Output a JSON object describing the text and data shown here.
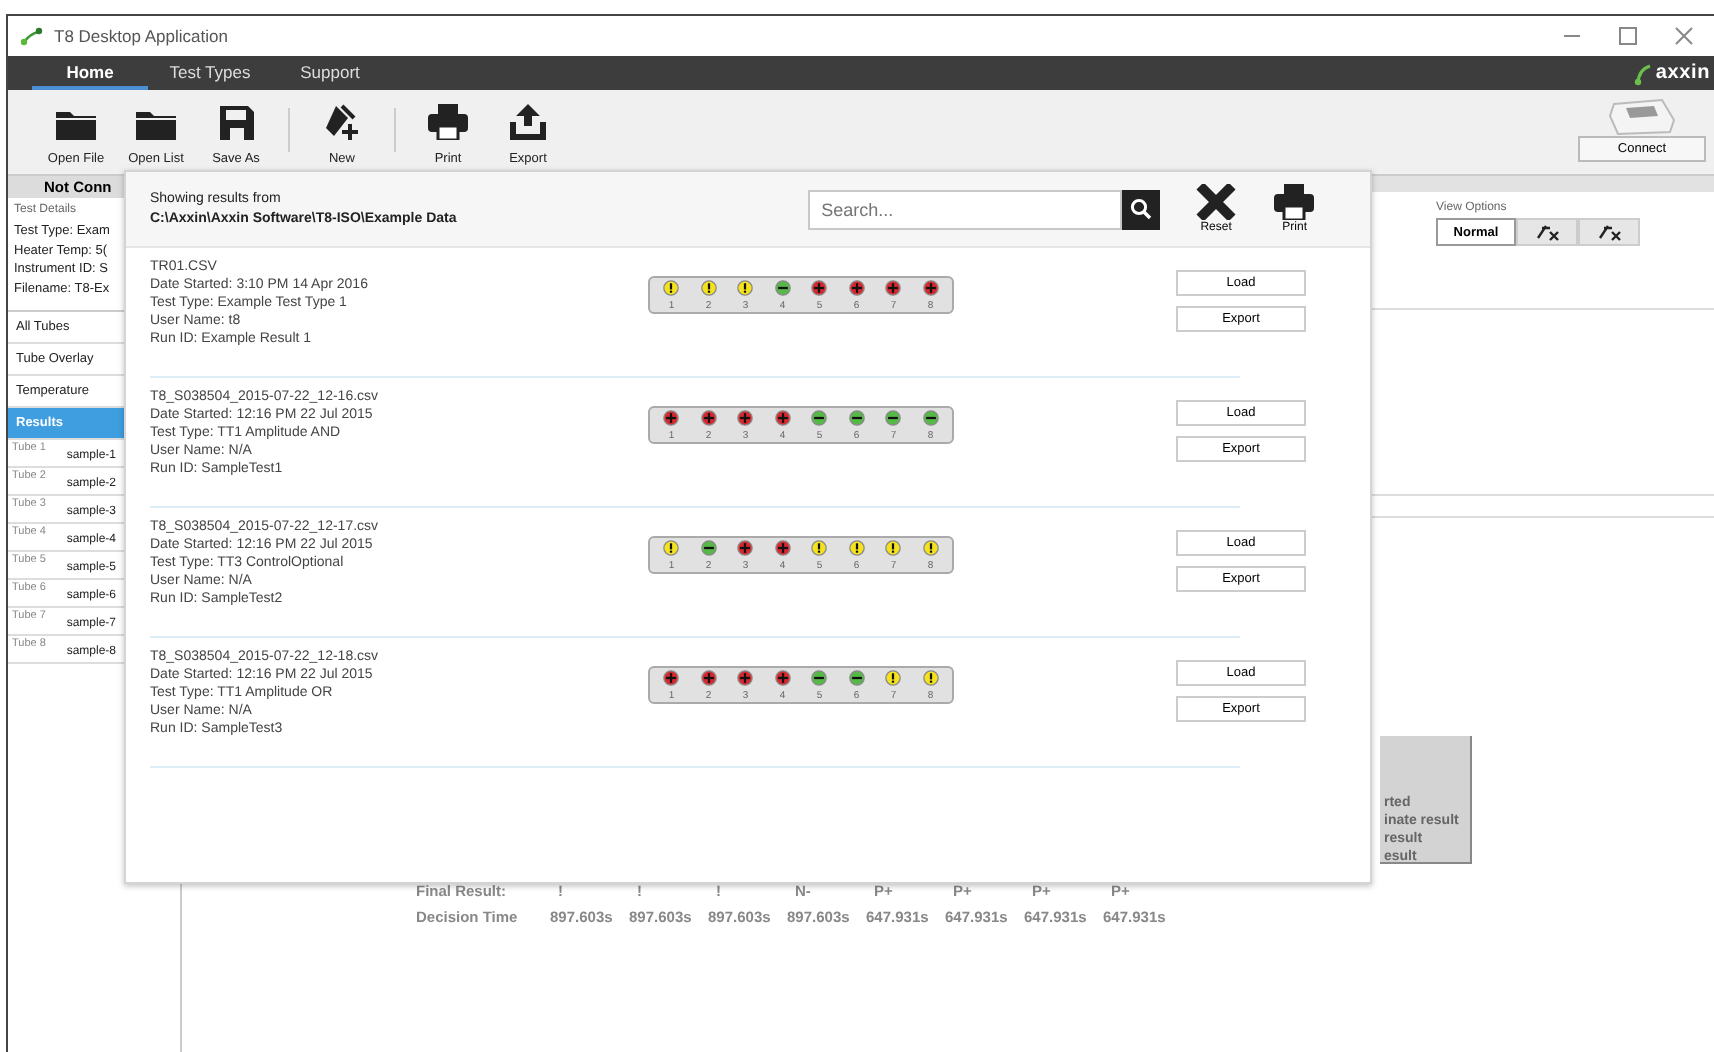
{
  "window": {
    "title": "T8 Desktop Application"
  },
  "menu_tabs": [
    {
      "label": "Home",
      "selected": true
    },
    {
      "label": "Test Types",
      "selected": false
    },
    {
      "label": "Support",
      "selected": false
    }
  ],
  "brand": "axxin",
  "toolbar": [
    {
      "label": "Open File",
      "kind": "folder"
    },
    {
      "label": "Open List",
      "kind": "folder"
    },
    {
      "label": "Save As",
      "kind": "save"
    },
    {
      "label": "New",
      "kind": "new"
    },
    {
      "label": "Print",
      "kind": "print"
    },
    {
      "label": "Export",
      "kind": "export"
    }
  ],
  "connect_button": "Connect",
  "status": "Not Conn",
  "test_details": {
    "heading": "Test Details",
    "lines": [
      "Test Type: Exam",
      "Heater Temp: 5(",
      "Instrument ID: S",
      "Filename: T8-Ex"
    ]
  },
  "nav": [
    {
      "label": "All Tubes",
      "selected": false
    },
    {
      "label": "Tube Overlay",
      "selected": false
    },
    {
      "label": "Temperature",
      "selected": false
    },
    {
      "label": "Results",
      "selected": true
    }
  ],
  "tubes": [
    {
      "label": "Tube 1",
      "sample": "sample-1"
    },
    {
      "label": "Tube 2",
      "sample": "sample-2"
    },
    {
      "label": "Tube 3",
      "sample": "sample-3"
    },
    {
      "label": "Tube 4",
      "sample": "sample-4"
    },
    {
      "label": "Tube 5",
      "sample": "sample-5"
    },
    {
      "label": "Tube 6",
      "sample": "sample-6"
    },
    {
      "label": "Tube 7",
      "sample": "sample-7"
    },
    {
      "label": "Tube 8",
      "sample": "sample-8"
    }
  ],
  "view_options": {
    "heading": "View Options",
    "buttons": [
      {
        "kind": "text",
        "label": "Normal",
        "selected": true
      },
      {
        "kind": "fx",
        "selected": false
      },
      {
        "kind": "fx",
        "selected": false
      }
    ]
  },
  "legend": [
    "rted",
    "inate result",
    "result",
    "esult"
  ],
  "results_table": [
    {
      "label": "Final Result:",
      "cells": [
        "!",
        "!",
        "!",
        "N-",
        "P+",
        "P+",
        "P+",
        "P+"
      ]
    },
    {
      "label": "Decision Time",
      "cells": [
        "897.603s",
        "897.603s",
        "897.603s",
        "897.603s",
        "647.931s",
        "647.931s",
        "647.931s",
        "647.931s"
      ]
    }
  ],
  "dialog": {
    "heading": "Showing results from",
    "path": "C:\\Axxin\\Axxin Software\\T8-ISO\\Example Data",
    "search": {
      "placeholder": "Search..."
    },
    "actions": [
      {
        "label": "Reset",
        "kind": "reset"
      },
      {
        "label": "Print",
        "kind": "print"
      }
    ],
    "results": [
      {
        "lines": [
          "TR01.CSV",
          "Date Started: 3:10 PM 14 Apr 2016",
          "Test Type: Example Test Type 1",
          "User Name: t8",
          "Run ID: Example Result 1"
        ],
        "tubes": [
          {
            "number": "1",
            "kind": "warning"
          },
          {
            "number": "2",
            "kind": "warning"
          },
          {
            "number": "3",
            "kind": "warning"
          },
          {
            "number": "4",
            "kind": "negative"
          },
          {
            "number": "5",
            "kind": "positive"
          },
          {
            "number": "6",
            "kind": "positive"
          },
          {
            "number": "7",
            "kind": "positive"
          },
          {
            "number": "8",
            "kind": "positive"
          }
        ],
        "buttons": [
          "Load",
          "Export"
        ]
      },
      {
        "lines": [
          "T8_S038504_2015-07-22_12-16.csv",
          "Date Started: 12:16 PM 22 Jul 2015",
          "Test Type: TT1 Amplitude AND",
          "User Name: N/A",
          "Run ID: SampleTest1"
        ],
        "tubes": [
          {
            "number": "1",
            "kind": "positive"
          },
          {
            "number": "2",
            "kind": "positive"
          },
          {
            "number": "3",
            "kind": "positive"
          },
          {
            "number": "4",
            "kind": "positive"
          },
          {
            "number": "5",
            "kind": "negative"
          },
          {
            "number": "6",
            "kind": "negative"
          },
          {
            "number": "7",
            "kind": "negative"
          },
          {
            "number": "8",
            "kind": "negative"
          }
        ],
        "buttons": [
          "Load",
          "Export"
        ]
      },
      {
        "lines": [
          "T8_S038504_2015-07-22_12-17.csv",
          "Date Started: 12:16 PM 22 Jul 2015",
          "Test Type: TT3 ControlOptional",
          "User Name: N/A",
          "Run ID: SampleTest2"
        ],
        "tubes": [
          {
            "number": "1",
            "kind": "warning"
          },
          {
            "number": "2",
            "kind": "negative"
          },
          {
            "number": "3",
            "kind": "positive"
          },
          {
            "number": "4",
            "kind": "positive"
          },
          {
            "number": "5",
            "kind": "warning"
          },
          {
            "number": "6",
            "kind": "warning"
          },
          {
            "number": "7",
            "kind": "warning"
          },
          {
            "number": "8",
            "kind": "warning"
          }
        ],
        "buttons": [
          "Load",
          "Export"
        ]
      },
      {
        "lines": [
          "T8_S038504_2015-07-22_12-18.csv",
          "Date Started: 12:16 PM 22 Jul 2015",
          "Test Type: TT1 Amplitude OR",
          "User Name: N/A",
          "Run ID: SampleTest3"
        ],
        "tubes": [
          {
            "number": "1",
            "kind": "positive"
          },
          {
            "number": "2",
            "kind": "positive"
          },
          {
            "number": "3",
            "kind": "positive"
          },
          {
            "number": "4",
            "kind": "positive"
          },
          {
            "number": "5",
            "kind": "negative"
          },
          {
            "number": "6",
            "kind": "negative"
          },
          {
            "number": "7",
            "kind": "warning"
          },
          {
            "number": "8",
            "kind": "warning"
          }
        ],
        "buttons": [
          "Load",
          "Export"
        ]
      }
    ]
  }
}
